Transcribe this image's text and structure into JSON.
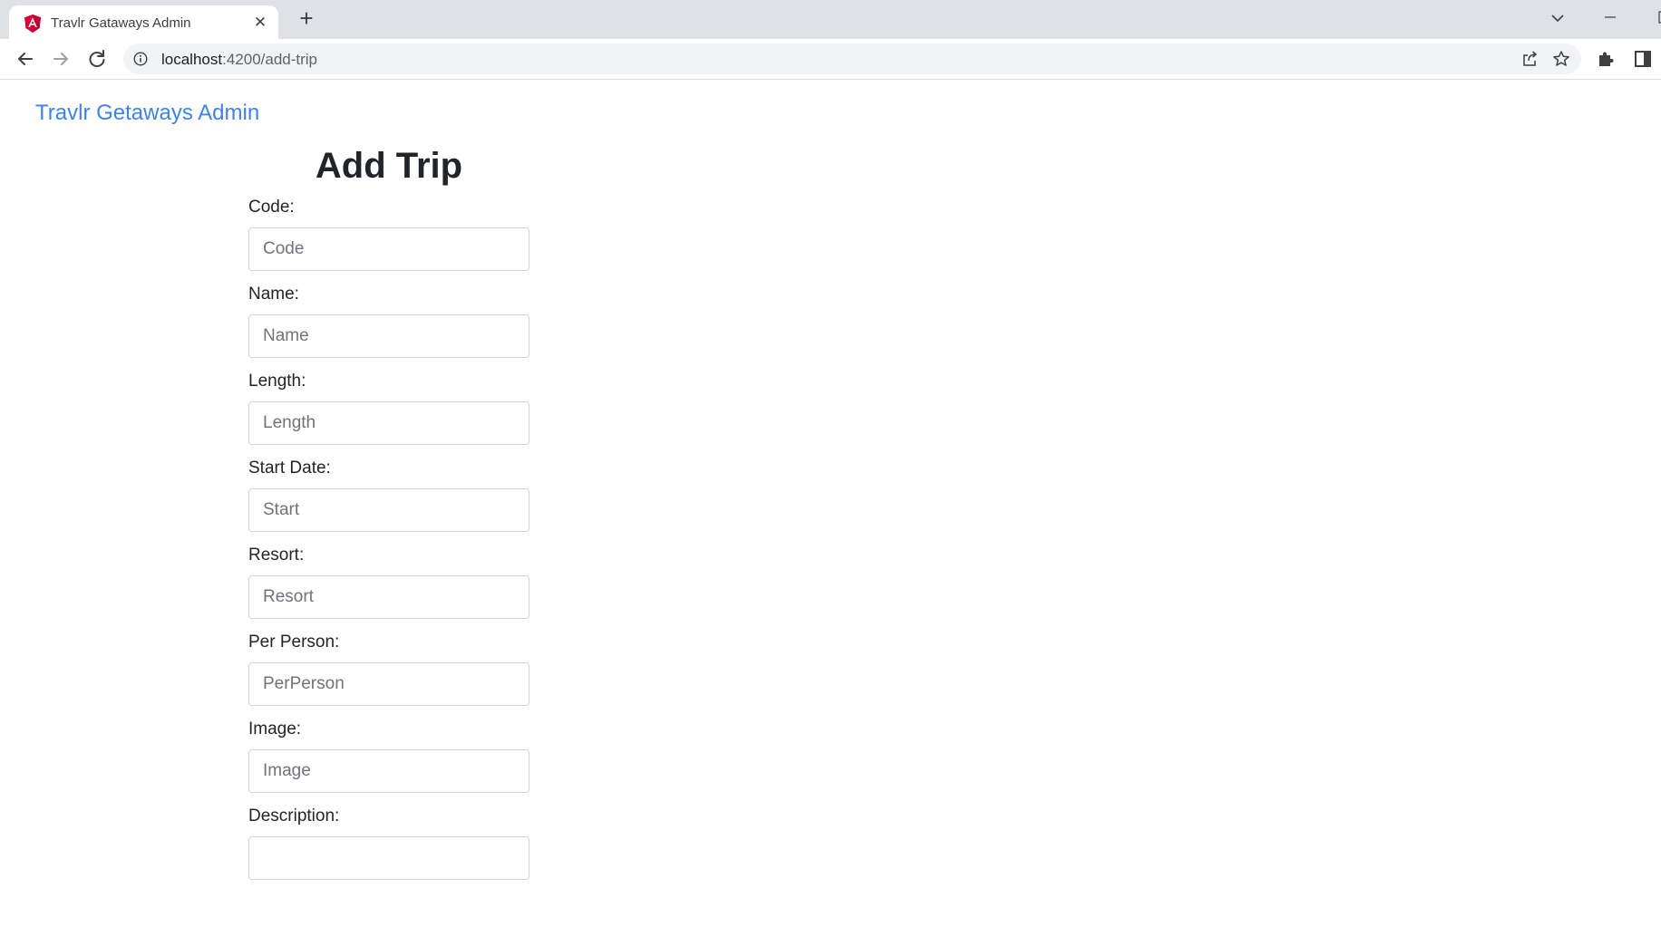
{
  "browser": {
    "tab_title": "Travlr Gataways Admin",
    "url_host": "localhost",
    "url_path": ":4200/add-trip"
  },
  "page": {
    "brand": "Travlr Getaways Admin",
    "title": "Add Trip",
    "fields": [
      {
        "label": "Code:",
        "placeholder": "Code"
      },
      {
        "label": "Name:",
        "placeholder": "Name"
      },
      {
        "label": "Length:",
        "placeholder": "Length"
      },
      {
        "label": "Start Date:",
        "placeholder": "Start"
      },
      {
        "label": "Resort:",
        "placeholder": "Resort"
      },
      {
        "label": "Per Person:",
        "placeholder": "PerPerson"
      },
      {
        "label": "Image:",
        "placeholder": "Image"
      },
      {
        "label": "Description:",
        "placeholder": ""
      }
    ]
  },
  "colors": {
    "brand_link": "#3b82f6",
    "tab_strip": "#dee1e6",
    "favicon": "#dd0031"
  }
}
